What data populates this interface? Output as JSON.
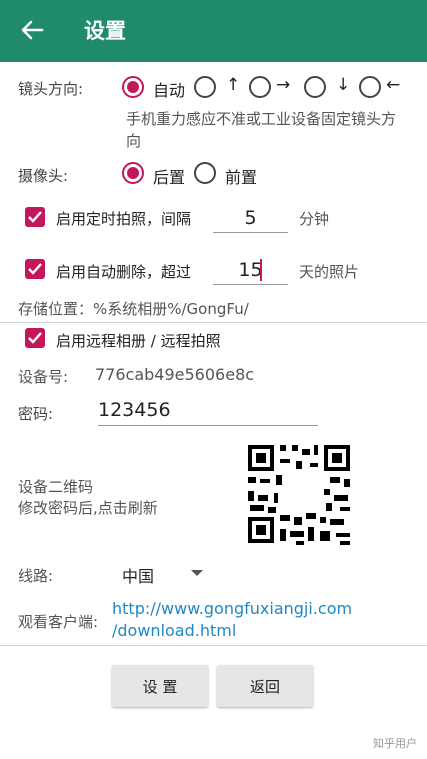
{
  "header": {
    "title": "设置"
  },
  "orientation": {
    "label": "镜头方向:",
    "options": [
      "自动",
      "↑",
      "→",
      "↓",
      "←"
    ],
    "selected": "自动",
    "hint_line1": "手机重力感应不准或工业设备固定镜头方",
    "hint_line2": "向"
  },
  "camera": {
    "label": "摄像头:",
    "options": [
      "后置",
      "前置"
    ],
    "selected": "后置"
  },
  "timer": {
    "label": "启用定时拍照，间隔",
    "value": "5",
    "unit": "分钟",
    "checked": true
  },
  "autodelete": {
    "label": "启用自动删除，超过",
    "value": "15",
    "unit": "天的照片",
    "checked": true
  },
  "storage": {
    "text": "存储位置：%系统相册%/GongFu/"
  },
  "remote": {
    "label": "启用远程相册 / 远程拍照",
    "checked": true
  },
  "device": {
    "label": "设备号:",
    "value": "776cab49e5606e8c"
  },
  "password": {
    "label": "密码:",
    "value": "123456"
  },
  "qrcode": {
    "label": "设备二维码",
    "hint": "修改密码后,点击刷新"
  },
  "line": {
    "label": "线路:",
    "selected": "中国"
  },
  "client": {
    "label": "观看客户端:",
    "url_line1": "http://www.gongfuxiangji.com",
    "url_line2": "/download.html"
  },
  "buttons": {
    "settings": "设 置",
    "back": "返回"
  },
  "watermark": "知乎用户",
  "colors": {
    "appbar": "#1f8a6c",
    "accent": "#c2185b",
    "link": "#1e88c7"
  }
}
